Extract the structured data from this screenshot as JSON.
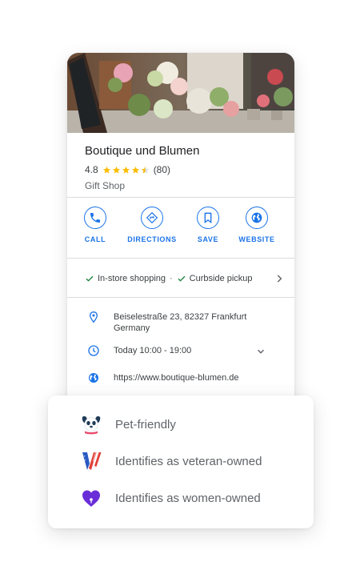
{
  "place": {
    "name": "Boutique und Blumen",
    "rating": "4.8",
    "reviews": "(80)",
    "category": "Gift Shop"
  },
  "actions": [
    {
      "label": "CALL",
      "icon": "phone-icon"
    },
    {
      "label": "DIRECTIONS",
      "icon": "directions-icon"
    },
    {
      "label": "SAVE",
      "icon": "bookmark-icon"
    },
    {
      "label": "WEBSITE",
      "icon": "globe-icon"
    }
  ],
  "services": {
    "item1": "In-store shopping",
    "separator": "·",
    "item2": "Curbside pickup"
  },
  "details": {
    "address_line1": "Beiselestraße 23, 82327 Frankfurt",
    "address_line2": "Germany",
    "hours": "Today 10:00 - 19:00",
    "website": "https://www.boutique-blumen.de"
  },
  "attributes": [
    {
      "label": "Pet-friendly",
      "icon": "pet-friendly-icon"
    },
    {
      "label": "Identifies as veteran-owned",
      "icon": "veteran-owned-icon"
    },
    {
      "label": "Identifies as women-owned",
      "icon": "women-owned-icon"
    }
  ],
  "colors": {
    "accent": "#1a73e8",
    "star": "#fbbc04",
    "check": "#188038",
    "divider": "#dadce0"
  }
}
